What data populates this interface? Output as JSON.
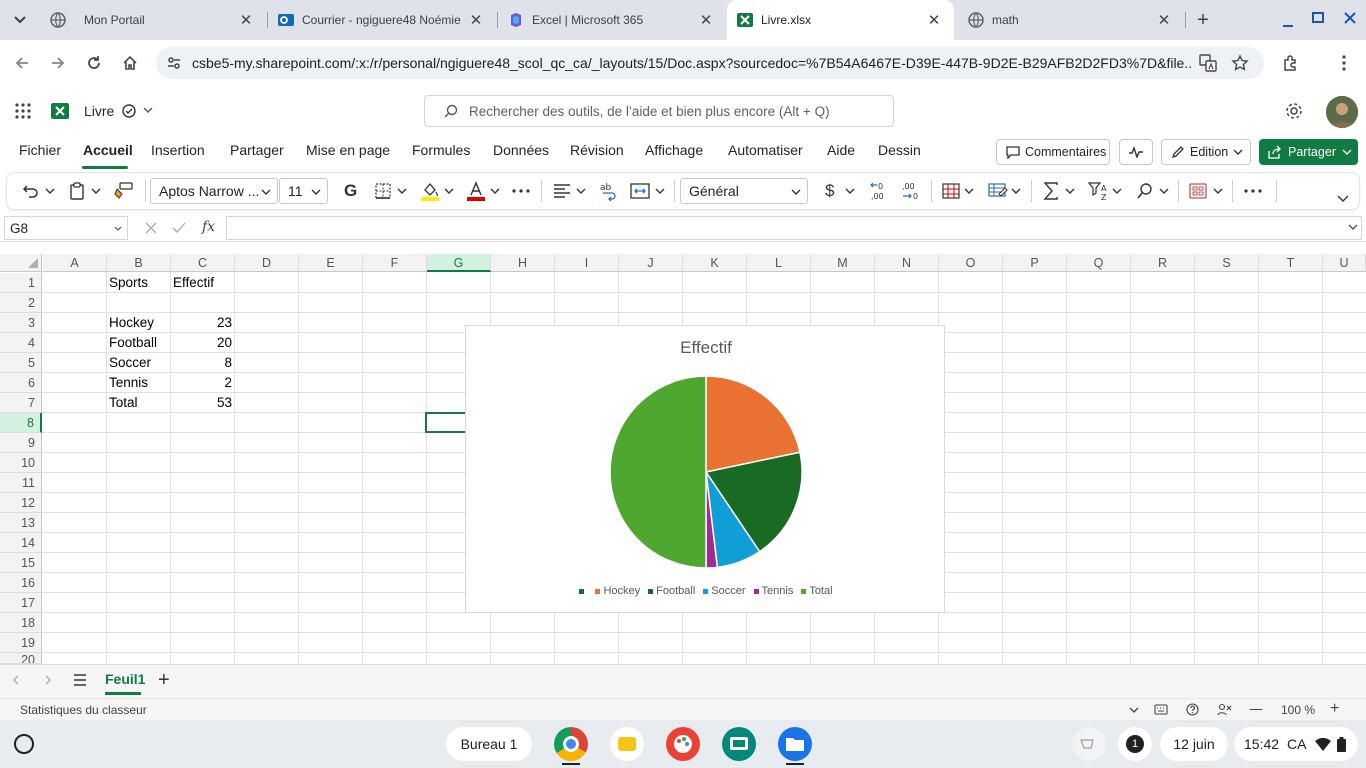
{
  "browser": {
    "tabs": [
      {
        "title": "Mon Portail"
      },
      {
        "title": "Courrier - ngiguere48 Noémie"
      },
      {
        "title": "Excel | Microsoft 365"
      },
      {
        "title": "Livre.xlsx"
      },
      {
        "title": "math"
      }
    ],
    "active_tab_index": 3,
    "url": "csbe5-my.sharepoint.com/:x:/r/personal/ngiguere48_scol_qc_ca/_layouts/15/Doc.aspx?sourcedoc=%7B54A6467E-D39E-447B-9D2E-B29AFB2D2FD3%7D&file..."
  },
  "excel": {
    "doc_title": "Livre",
    "search_placeholder": "Rechercher des outils, de l’aide et bien plus encore (Alt + Q)",
    "menu": [
      "Fichier",
      "Accueil",
      "Insertion",
      "Partager",
      "Mise en page",
      "Formules",
      "Données",
      "Révision",
      "Affichage",
      "Automatiser",
      "Aide",
      "Dessin"
    ],
    "active_menu": "Accueil",
    "comments_label": "Commentaires",
    "edit_mode_label": "Edition",
    "share_label": "Partager",
    "font_name": "Aptos Narrow ...",
    "font_size": "11",
    "bold_label": "G",
    "number_format": "Général",
    "currency_symbol": "$",
    "name_box": "G8",
    "fx_label": "fx",
    "columns": [
      "A",
      "B",
      "C",
      "D",
      "E",
      "F",
      "G",
      "H",
      "I",
      "J",
      "K",
      "L",
      "M",
      "N",
      "O",
      "P",
      "Q",
      "R",
      "S",
      "T",
      "U"
    ],
    "selected_column": "G",
    "rows": [
      "1",
      "2",
      "3",
      "4",
      "5",
      "6",
      "7",
      "8",
      "9",
      "10",
      "11",
      "12",
      "13",
      "14",
      "15",
      "16",
      "17",
      "18",
      "19",
      "20"
    ],
    "selected_row": "8",
    "cells": {
      "B1": "Sports",
      "C1": "Effectif",
      "B3": "Hockey",
      "C3": "23",
      "B4": "Football",
      "C4": "20",
      "B5": "Soccer",
      "C5": "8",
      "B6": "Tennis",
      "C6": "2",
      "B7": "Total",
      "C7": "53"
    },
    "sheet_tab": "Feuil1",
    "status_text": "Statistiques du classeur",
    "zoom": "100 %"
  },
  "chart_data": {
    "type": "pie",
    "title": "Effectif",
    "categories": [
      "",
      "Hockey",
      "Football",
      "Soccer",
      "Tennis",
      "Total"
    ],
    "values": [
      0,
      23,
      20,
      8,
      2,
      53
    ],
    "colors": [
      "#156082",
      "#e97132",
      "#196b24",
      "#0f9ed5",
      "#a02b93",
      "#4ea72e"
    ],
    "legend_position": "bottom"
  },
  "taskbar": {
    "desk_label": "Bureau 1",
    "notification_count": "1",
    "date": "12 juin",
    "time": "15:42",
    "region": "CA"
  }
}
